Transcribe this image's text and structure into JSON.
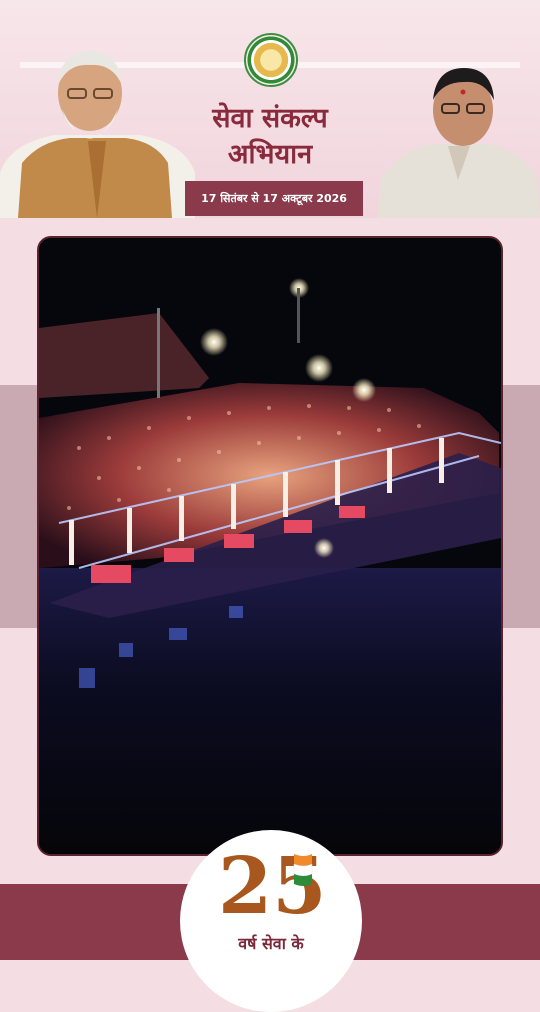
{
  "header": {
    "title_line1": "सेवा संकल्प",
    "title_line2": "अभियान",
    "date_range": "17 सितंबर से 17 अक्टूबर 2026"
  },
  "badge": {
    "number": "25",
    "caption": "वर्ष सेवा के"
  },
  "colors": {
    "accent": "#8a3a4b",
    "background": "#f4dde3",
    "band": "#c9a9b2",
    "title": "#8a2a3d"
  },
  "icons": {
    "emblem": "chhattisgarh-state-emblem-icon",
    "flag": "tricolor-flag-icon"
  }
}
